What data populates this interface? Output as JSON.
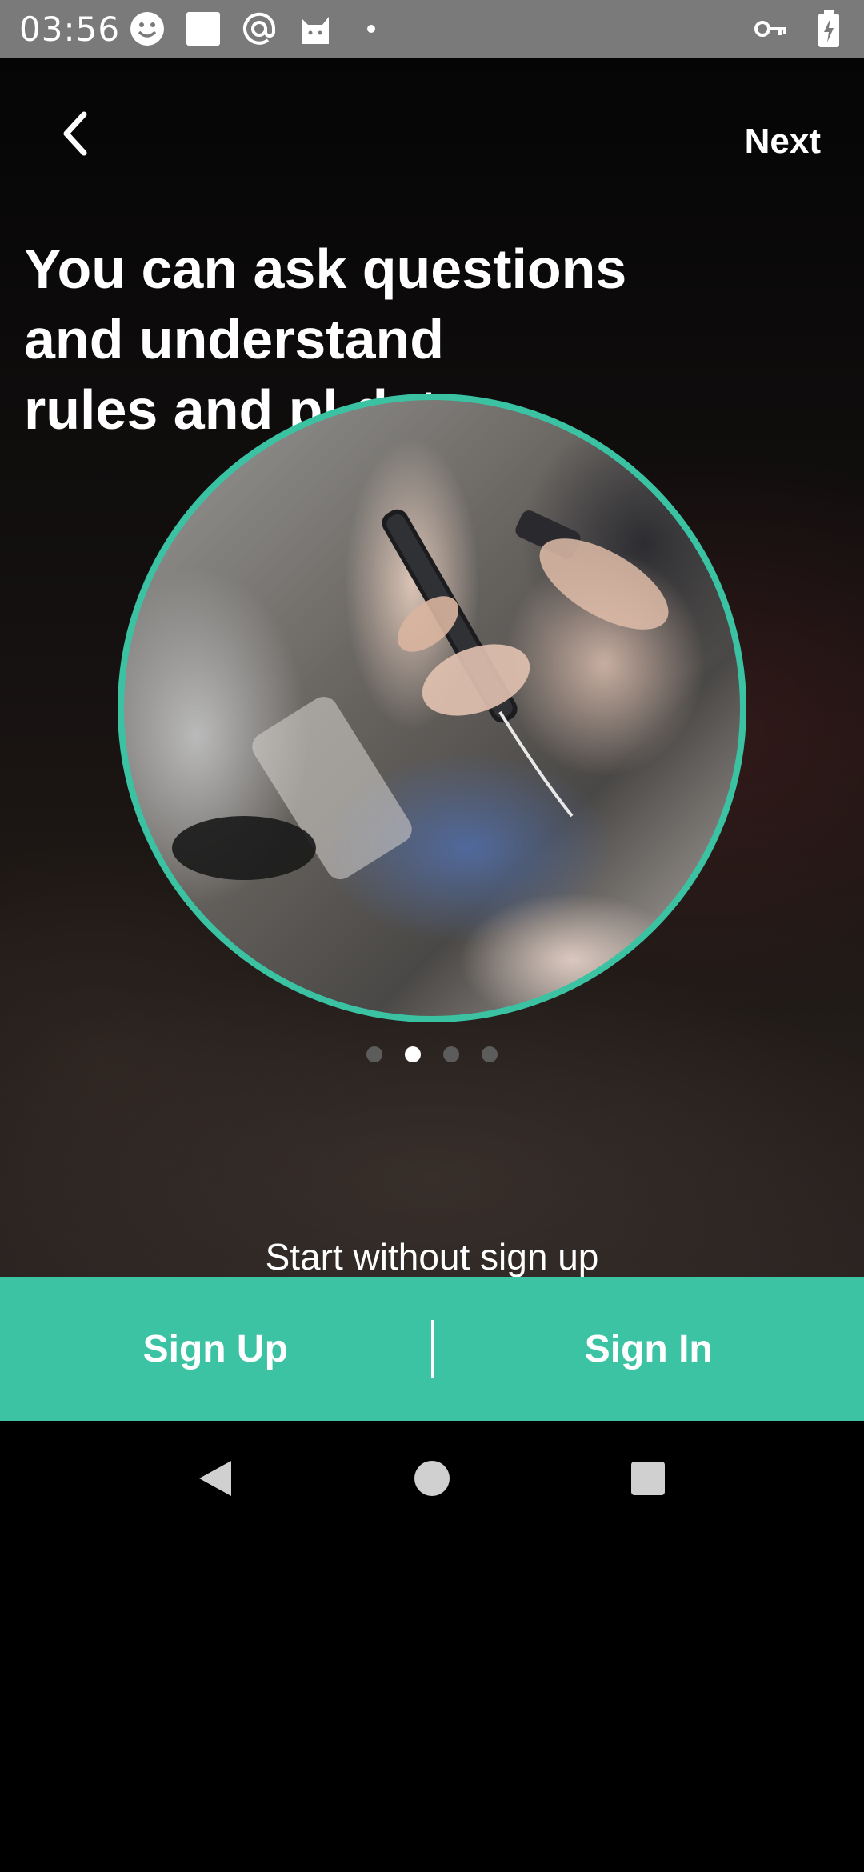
{
  "status_bar": {
    "time": "03:56",
    "left_icons": [
      "smiley-icon",
      "square-icon",
      "at-icon",
      "cat-icon",
      "dot-icon"
    ],
    "right_icons": [
      "key-icon",
      "battery-charging-icon"
    ]
  },
  "header": {
    "back_icon": "chevron-left-icon",
    "next_label": "Next"
  },
  "headline": {
    "lines": [
      "You can ask questions",
      "and understand",
      "rules and pl      data"
    ]
  },
  "carousel": {
    "total_pages": 4,
    "active_index": 1
  },
  "start_without_signup": "Start without sign up",
  "actions": {
    "sign_up": "Sign Up",
    "sign_in": "Sign In"
  },
  "colors": {
    "accent": "#3cc3a3",
    "dot_inactive": "#5c5c5c",
    "dot_active": "#ffffff"
  },
  "nav_bar": {
    "back": "triangle-back-icon",
    "home": "circle-home-icon",
    "recents": "square-recents-icon"
  }
}
